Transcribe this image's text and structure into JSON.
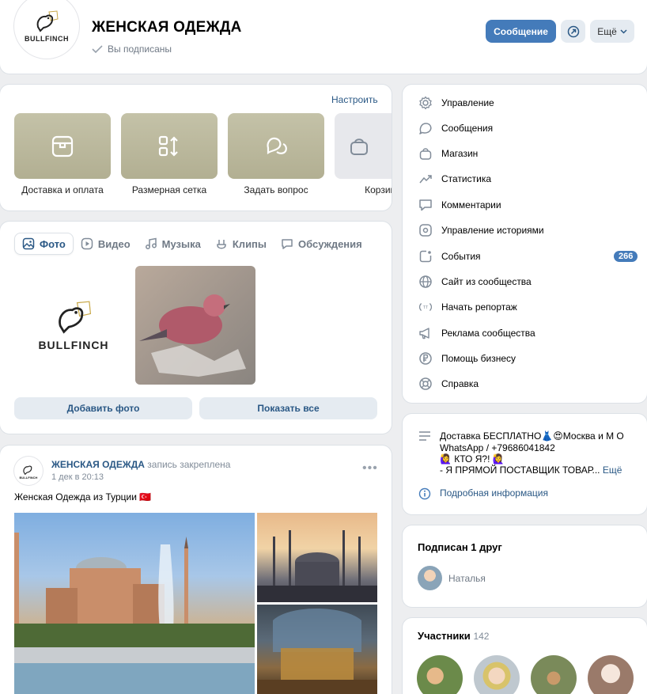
{
  "header": {
    "avatar_text": "BULLFINCH",
    "title": "ЖЕНСКАЯ ОДЕЖДА",
    "subscribed": "Вы подписаны",
    "message_button": "Сообщение",
    "more_button": "Ещё"
  },
  "shop": {
    "configure": "Настроить",
    "tiles": [
      {
        "label": "Доставка и оплата",
        "icon": "box-icon"
      },
      {
        "label": "Размерная сетка",
        "icon": "sort-icon"
      },
      {
        "label": "Задать вопрос",
        "icon": "chat-bubbles-icon"
      },
      {
        "label": "Корзина",
        "icon": "bag-icon"
      }
    ]
  },
  "media": {
    "tabs": [
      {
        "label": "Фото",
        "icon": "photo-icon",
        "active": true
      },
      {
        "label": "Видео",
        "icon": "video-icon"
      },
      {
        "label": "Музыка",
        "icon": "music-icon"
      },
      {
        "label": "Клипы",
        "icon": "clips-icon"
      },
      {
        "label": "Обсуждения",
        "icon": "discussion-icon"
      }
    ],
    "photo_logo_text": "BULLFINCH",
    "add_photo": "Добавить фото",
    "show_all": "Показать все"
  },
  "post": {
    "author": "ЖЕНСКАЯ ОДЕЖДА",
    "pinned": "запись закреплена",
    "date": "1 дек в 20:13",
    "text": "Женская Одежда из Турции 🇹🇷",
    "avatar_text": "BULLFINCH"
  },
  "menu": {
    "items": [
      {
        "label": "Управление",
        "icon": "gear-icon"
      },
      {
        "label": "Сообщения",
        "icon": "message-icon"
      },
      {
        "label": "Магазин",
        "icon": "bag-icon"
      },
      {
        "label": "Статистика",
        "icon": "chart-icon"
      },
      {
        "label": "Комментарии",
        "icon": "comment-icon"
      },
      {
        "label": "Управление историями",
        "icon": "stories-icon"
      },
      {
        "label": "События",
        "icon": "event-icon",
        "badge": "266"
      },
      {
        "label": "Сайт из сообщества",
        "icon": "globe-icon"
      },
      {
        "label": "Начать репортаж",
        "icon": "live-icon"
      },
      {
        "label": "Реклама сообщества",
        "icon": "megaphone-icon"
      },
      {
        "label": "Помощь бизнесу",
        "icon": "ruble-icon"
      },
      {
        "label": "Справка",
        "icon": "help-icon"
      }
    ]
  },
  "info": {
    "line1": "Доставка БЕСПЛАТНО👗😍Москва и М О",
    "line2": "WhatsApp / +79686041842",
    "line3": "🙋‍♀️ КТО Я?! 🙋‍♀️",
    "line4": "- Я ПРЯМОЙ ПОСТАВЩИК ТОВАР...",
    "more": "Ещё",
    "details": "Подробная информация"
  },
  "friends": {
    "title": "Подписан 1 друг",
    "name": "Наталья"
  },
  "members": {
    "title": "Участники",
    "count": "142"
  },
  "colors": {
    "accent": "#447bba",
    "link": "#2a5885",
    "secondary_button": "#e5ebf1",
    "background": "#edeef0"
  }
}
